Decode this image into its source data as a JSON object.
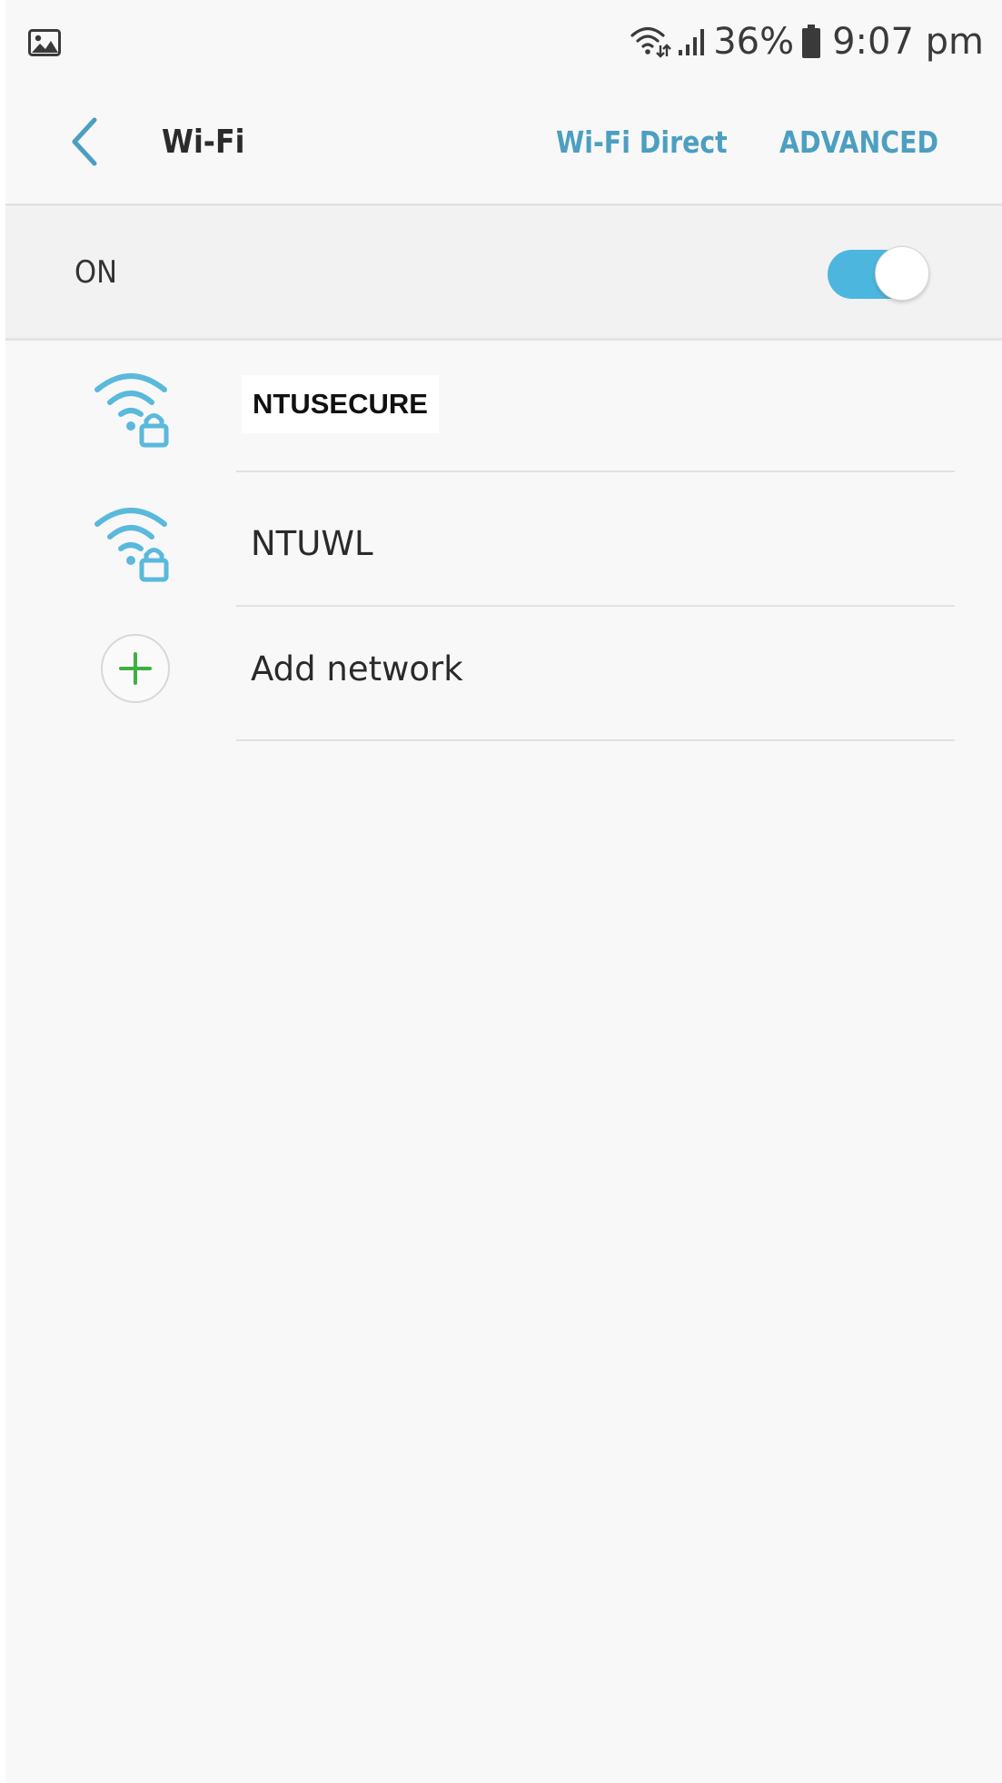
{
  "status_bar": {
    "notification_icon": "gallery-icon",
    "wifi_icon": "wifi-data-activity-icon",
    "signal_icon": "cellular-signal-icon",
    "battery_percent": "36%",
    "battery_icon": "battery-icon",
    "time": "9:07 pm"
  },
  "app_bar": {
    "back_icon": "chevron-left-icon",
    "title": "Wi-Fi",
    "wifi_direct_label": "Wi-Fi Direct",
    "advanced_label": "ADVANCED"
  },
  "master_switch": {
    "label": "ON",
    "checked": true
  },
  "networks": [
    {
      "ssid": "NTUSECURE",
      "icon": "wifi-locked-icon",
      "secured": true
    },
    {
      "ssid": "NTUWL",
      "icon": "wifi-locked-icon",
      "secured": true
    }
  ],
  "add_network": {
    "label": "Add network",
    "icon": "plus-icon"
  },
  "colors": {
    "accent": "#4c9fc1",
    "toggle_on": "#4db6df",
    "wifi_icon": "#5ab9dc",
    "add_plus": "#3cb043",
    "background": "#f8f8f8"
  }
}
